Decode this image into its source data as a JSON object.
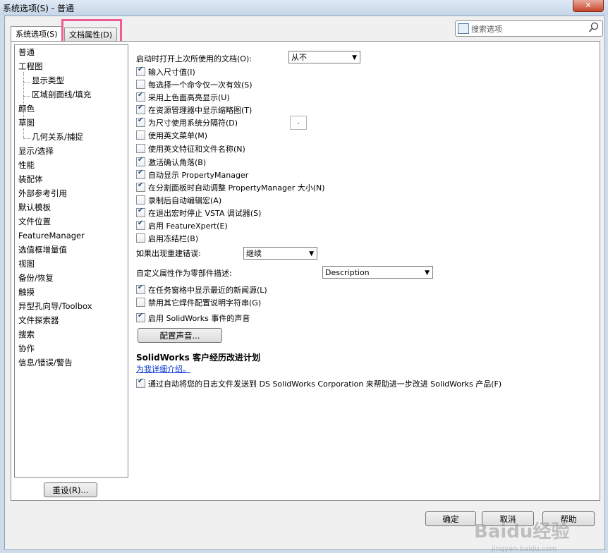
{
  "window": {
    "title": "系统选项(S) - 普通",
    "close_label": "✕"
  },
  "tabs": [
    {
      "label": "系统选项(S)"
    },
    {
      "label": "文档属性(D)"
    }
  ],
  "search": {
    "placeholder": "搜索选项"
  },
  "tree": [
    "普通",
    "工程图",
    "显示类型",
    "区域剖面线/填充",
    "颜色",
    "草图",
    "几何关系/捕捉",
    "显示/选择",
    "性能",
    "装配体",
    "外部参考引用",
    "默认模板",
    "文件位置",
    "FeatureManager",
    "选值框增量值",
    "视图",
    "备份/恢复",
    "触摸",
    "异型孔向导/Toolbox",
    "文件探索器",
    "搜索",
    "协作",
    "信息/错误/警告"
  ],
  "general": {
    "open_last_label": "启动时打开上次所使用的文档(O):",
    "open_last_value": "从不",
    "options": [
      {
        "label": "输入尺寸值(I)",
        "checked": true
      },
      {
        "label": "每选择一个命令仅一次有效(S)",
        "checked": false
      },
      {
        "label": "采用上色面高亮显示(U)",
        "checked": true
      },
      {
        "label": "在资源管理器中显示缩略图(T)",
        "checked": true
      },
      {
        "label": "为尺寸使用系统分隔符(D)",
        "checked": true
      },
      {
        "label": "使用英文菜单(M)",
        "checked": false
      },
      {
        "label": "使用英文特征和文件名称(N)",
        "checked": false
      },
      {
        "label": "激活确认角落(B)",
        "checked": true
      },
      {
        "label": "自动显示 PropertyManager",
        "checked": true
      },
      {
        "label": "在分割面板时自动调整 PropertyManager 大小(N)",
        "checked": true
      },
      {
        "label": "录制后自动编辑宏(A)",
        "checked": false
      },
      {
        "label": "在退出宏时停止 VSTA 调试器(S)",
        "checked": true
      },
      {
        "label": "启用 FeatureXpert(E)",
        "checked": true
      },
      {
        "label": "启用冻结栏(B)",
        "checked": false
      }
    ],
    "separator_value": ".",
    "rebuild_error_label": "如果出现重建错误:",
    "rebuild_error_value": "继续",
    "custom_prop_label": "自定义属性作为零部件描述:",
    "custom_prop_value": "Description",
    "options2": [
      {
        "label": "在任务窗格中显示最近的新闻源(L)",
        "checked": true
      },
      {
        "label": "禁用其它焊件配置说明字符串(G)",
        "checked": false
      }
    ],
    "sound_option": {
      "label": "启用 SolidWorks 事件的声音",
      "checked": true
    },
    "config_sound_button": "配置声音...",
    "program_title": "SolidWorks 客户经历改进计划",
    "program_link": "为我详细介绍。",
    "program_option": {
      "label": "通过自动将您的日志文件发送到 DS SolidWorks Corporation 来帮助进一步改进 SolidWorks 产品(F)",
      "checked": true
    }
  },
  "footer": {
    "reset_button": "重设(R)...",
    "ok_button": "确定",
    "cancel_button": "取消",
    "help_button": "帮助"
  },
  "watermark": {
    "text": "Baidu经验",
    "url": "jingyan.baidu.com"
  }
}
